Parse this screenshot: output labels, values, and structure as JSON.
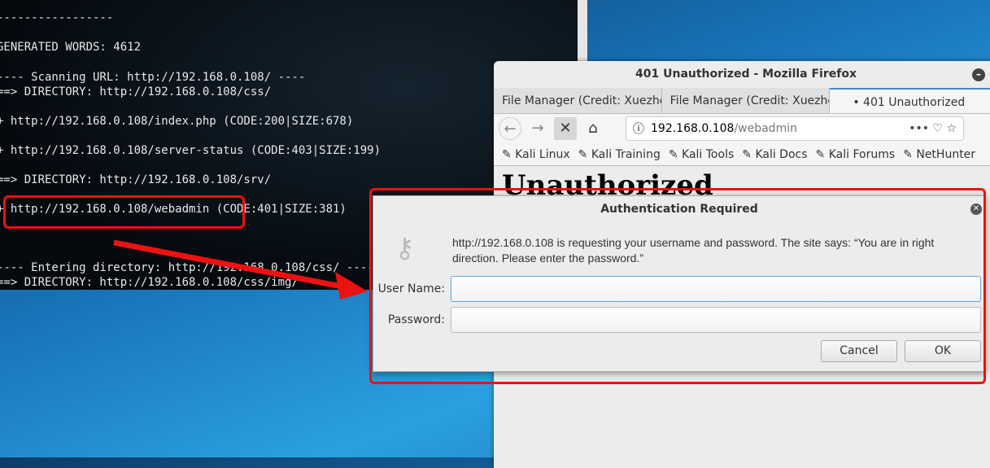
{
  "terminal": {
    "lines": [
      "-----------------",
      "GENERATED WORDS: 4612",
      "---- Scanning URL: http://192.168.0.108/ ----",
      "==> DIRECTORY: http://192.168.0.108/css/",
      "+ http://192.168.0.108/index.php (CODE:200|SIZE:678)",
      "+ http://192.168.0.108/server-status (CODE:403|SIZE:199)",
      "==> DIRECTORY: http://192.168.0.108/srv/",
      "+ http://192.168.0.108/webadmin (CODE:401|SIZE:381)",
      "---- Entering directory: http://192.168.0.108/css/ ----",
      "==> DIRECTORY: http://192.168.0.108/css/img/"
    ]
  },
  "firefox": {
    "title": "401 Unauthorized - Mozilla Firefox",
    "tabs": [
      {
        "label": "File Manager (Credit: Xuezhe"
      },
      {
        "label": "File Manager (Credit: Xuezhe"
      },
      {
        "label": "• 401 Unauthorized"
      }
    ],
    "url_host": "192.168.0.108",
    "url_path": "/webadmin",
    "bookmarks": [
      "Kali Linux",
      "Kali Training",
      "Kali Tools",
      "Kali Docs",
      "Kali Forums",
      "NetHunter"
    ],
    "page_heading": "Unauthorized"
  },
  "dialog": {
    "title": "Authentication Required",
    "message": "http://192.168.0.108 is requesting your username and password. The site says: “You are in right direction. Please enter the password.”",
    "username_label": "User Name:",
    "password_label": "Password:",
    "username_value": "",
    "password_value": "",
    "cancel": "Cancel",
    "ok": "OK"
  },
  "annotation_color": "#ee1111"
}
